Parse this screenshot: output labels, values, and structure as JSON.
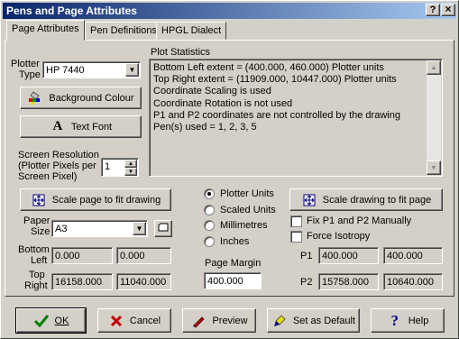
{
  "window": {
    "title": "Pens and Page Attributes",
    "help_glyph": "?",
    "close_glyph": "×"
  },
  "tabs": [
    {
      "label": "Page Attributes",
      "active": true
    },
    {
      "label": "Pen Definitions",
      "active": false
    },
    {
      "label": "HPGL Dialect",
      "active": false
    }
  ],
  "plotter": {
    "label_line1": "Plotter",
    "label_line2": "Type",
    "selected": "HP 7440"
  },
  "buttons": {
    "background_colour": "Background Colour",
    "text_font": "Text Font",
    "scale_page": "Scale page to fit drawing",
    "scale_drawing": "Scale drawing to fit page"
  },
  "plot_statistics": {
    "title": "Plot Statistics",
    "lines": [
      "Bottom Left extent = (400.000, 460.000) Plotter units",
      "Top Right extent = (11909.000, 10447.000) Plotter units",
      "Coordinate Scaling is used",
      "Coordinate Rotation is not used",
      "P1 and P2 coordinates are not controlled by the drawing",
      "Pen(s) used = 1, 2, 3, 5"
    ]
  },
  "screen_resolution": {
    "label_line1": "Screen Resolution",
    "label_line2": "(Plotter Pixels per",
    "label_line3": "Screen Pixel)",
    "value": "1"
  },
  "units": {
    "options": [
      "Plotter Units",
      "Scaled Units",
      "Millimetres",
      "Inches"
    ],
    "selected_index": 0
  },
  "paper": {
    "label_line1": "Paper",
    "label_line2": "Size",
    "selected": "A3"
  },
  "bottom_left": {
    "label_line1": "Bottom",
    "label_line2": "Left",
    "x": "0.000",
    "y": "0.000"
  },
  "top_right": {
    "label_line1": "Top",
    "label_line2": "Right",
    "x": "16158.000",
    "y": "11040.000"
  },
  "page_margin": {
    "label": "Page Margin",
    "value": "400.000"
  },
  "checks": {
    "fix_p1p2": "Fix P1 and P2 Manually",
    "force_isotropy": "Force Isotropy"
  },
  "p1": {
    "label": "P1",
    "x": "400.000",
    "y": "400.000"
  },
  "p2": {
    "label": "P2",
    "x": "15758.000",
    "y": "10640.000"
  },
  "footer": {
    "ok": "OK",
    "cancel": "Cancel",
    "preview": "Preview",
    "set_default": "Set as Default",
    "help": "Help"
  }
}
